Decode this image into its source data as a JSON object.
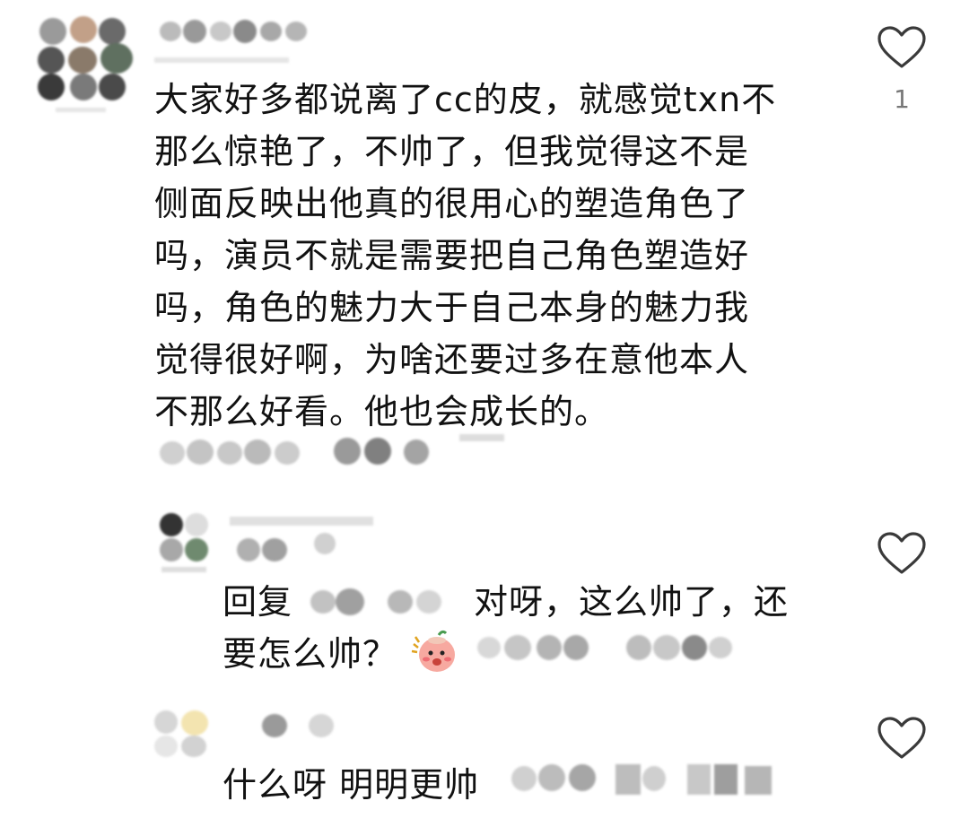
{
  "comment": {
    "text": "大家好多都说离了cc的皮，就感觉txn不\n那么惊艳了，不帅了，但我觉得这不是\n侧面反映出他真的很用心的塑造角色了\n吗，演员不就是需要把自己角色塑造好\n吗，角色的魅力大于自己本身的魅力我\n觉得很好啊，为啥还要过多在意他本人\n不那么好看。他也会成长的。",
    "like_count": "1",
    "like_icon": "heart-outline-icon"
  },
  "replies": [
    {
      "prefix": "回复",
      "text_line1": "对呀，这么帅了，还",
      "text_line2": "要怎么帅？",
      "emoji": "blushing-face-emoji",
      "like_icon": "heart-outline-icon"
    },
    {
      "text": "什么呀 明明更帅",
      "like_icon": "heart-outline-icon"
    }
  ],
  "colors": {
    "text": "#111111",
    "like_count": "#777777",
    "heart_stroke": "#3a3a3a",
    "obscured_blob": "#9a9a9a"
  }
}
